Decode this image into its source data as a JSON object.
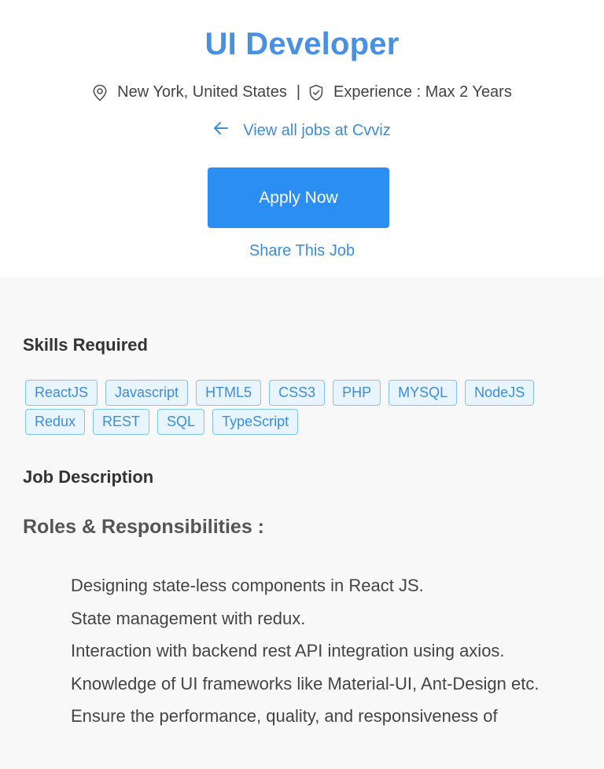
{
  "job": {
    "title": "UI Developer",
    "location": "New York, United States",
    "separator": "|",
    "experience": "Experience : Max 2 Years",
    "view_all_link": "View all jobs at Cvviz",
    "apply_label": "Apply Now",
    "share_label": "Share This Job"
  },
  "skills": {
    "heading": "Skills Required",
    "tags": [
      "ReactJS",
      "Javascript",
      "HTML5",
      "CSS3",
      "PHP",
      "MYSQL",
      "NodeJS",
      "Redux",
      "REST",
      "SQL",
      "TypeScript"
    ]
  },
  "description": {
    "heading": "Job Description",
    "roles_heading": "Roles & Responsibilities :",
    "items": [
      "Designing state-less components in React JS.",
      "State management with redux.",
      "Interaction with backend rest API integration using axios.",
      "Knowledge of UI frameworks like Material-UI, Ant-Design etc.",
      "Ensure the performance, quality, and responsiveness of"
    ]
  },
  "colors": {
    "accent": "#4a90e2",
    "link": "#3c8dde",
    "button": "#2b8ef2",
    "tag_border": "#7cc4f5",
    "tag_background": "#e8f5fe",
    "content_background": "#f8f8f8"
  },
  "icons": {
    "location": "location-pin-icon",
    "experience": "shield-check-icon",
    "back": "arrow-left-icon"
  }
}
